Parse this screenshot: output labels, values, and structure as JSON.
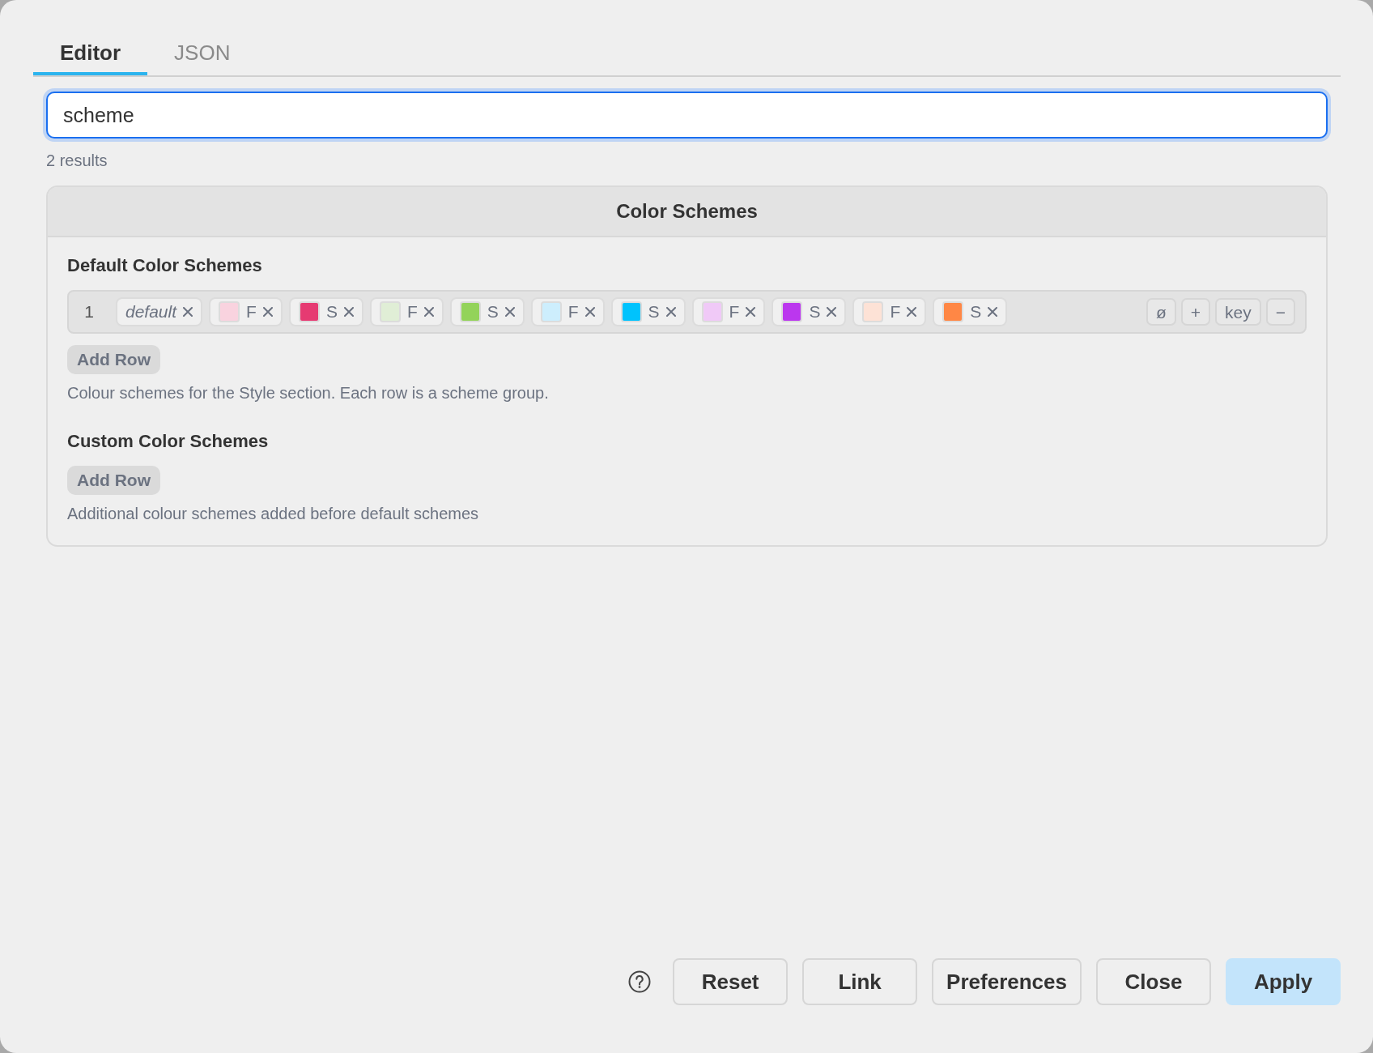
{
  "tabs": [
    {
      "label": "Editor",
      "selected": true
    },
    {
      "label": "JSON",
      "selected": false
    }
  ],
  "search": {
    "value": "scheme"
  },
  "result_count": "2 results",
  "section": {
    "title": "Color Schemes",
    "fields": [
      {
        "label": "Default Color Schemes",
        "rows": [
          {
            "index": "1",
            "name": "default",
            "swatches": [
              {
                "label": "F",
                "color": "#f9d3df"
              },
              {
                "label": "S",
                "color": "#e63a72"
              },
              {
                "label": "F",
                "color": "#e0eed6"
              },
              {
                "label": "S",
                "color": "#93d35a"
              },
              {
                "label": "F",
                "color": "#cdeefd"
              },
              {
                "label": "S",
                "color": "#00c3fd"
              },
              {
                "label": "F",
                "color": "#f0c9f7"
              },
              {
                "label": "S",
                "color": "#bb37ee"
              },
              {
                "label": "F",
                "color": "#fde2d6"
              },
              {
                "label": "S",
                "color": "#ff8745"
              }
            ],
            "actions": [
              "ø",
              "+",
              "key",
              "−"
            ]
          }
        ],
        "add_button": "Add Row",
        "help": "Colour schemes for the Style section. Each row is a scheme group."
      },
      {
        "label": "Custom Color Schemes",
        "add_button": "Add Row",
        "help": "Additional colour schemes added before default schemes"
      }
    ]
  },
  "footer": {
    "buttons": [
      {
        "label": "Reset",
        "kind": "default"
      },
      {
        "label": "Link",
        "kind": "default"
      },
      {
        "label": "Preferences",
        "kind": "default"
      },
      {
        "label": "Close",
        "kind": "default"
      },
      {
        "label": "Apply",
        "kind": "primary"
      }
    ]
  }
}
